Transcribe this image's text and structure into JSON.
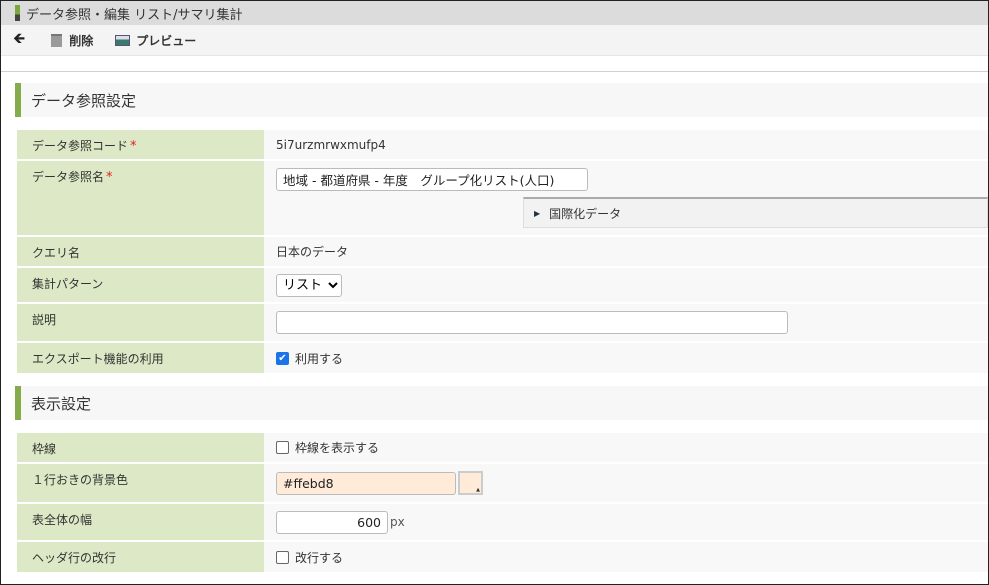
{
  "title": "データ参照・編集 リスト/サマリ集計",
  "toolbar": {
    "back_icon": "arrow-left-icon",
    "delete": "削除",
    "preview": "プレビュー"
  },
  "section1": {
    "title": "データ参照設定",
    "code_label": "データ参照コード",
    "code_value": "5i7urzmrwxmufp4",
    "name_label": "データ参照名",
    "name_value": "地域 - 都道府県 - 年度　グループ化リスト(人口)",
    "i18n": "国際化データ",
    "query_label": "クエリ名",
    "query_value": "日本のデータ",
    "pattern_label": "集計パターン",
    "pattern_value": "リスト",
    "desc_label": "説明",
    "desc_value": "",
    "export_label": "エクスポート機能の利用",
    "export_check": "利用する",
    "export_checked": true,
    "required_mark": "*"
  },
  "section2": {
    "title": "表示設定",
    "border_label": "枠線",
    "border_check": "枠線を表示する",
    "border_checked": false,
    "altcolor_label": "１行おきの背景色",
    "altcolor_value": "#ffebd8",
    "width_label": "表全体の幅",
    "width_value": "600",
    "width_unit": "px",
    "wrap_label": "ヘッダ行の改行",
    "wrap_check": "改行する",
    "wrap_checked": false
  }
}
